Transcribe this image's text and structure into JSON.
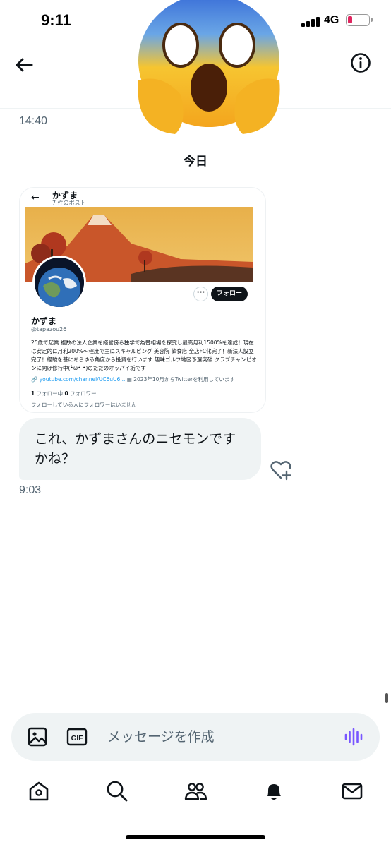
{
  "status_bar": {
    "time": "9:11",
    "network": "4G",
    "battery_color": "#e0245e"
  },
  "header": {
    "back_icon": "back-arrow-icon",
    "info_icon": "info-icon",
    "sticker_icon": "screaming-face-emoji"
  },
  "conversation": {
    "earlier_timestamp": "14:40",
    "date_separator": "今日",
    "attached_screenshot": {
      "back_glyph": "←",
      "top_name": "かずま",
      "posts_count": "7 件のポスト",
      "more_glyph": "···",
      "follow_label": "フォロー",
      "display_name": "かずま",
      "handle": "@tapazou26",
      "bio": "25歳で起業 複数の法人企業を経営傍ら独学で為替相場を探究し最高月利1500%を達成！現在は安定的に月利200%〜程度で主にスキャルピング 美容院 飲食店 全店FC化完了！新法人設立完了！経験を基にあらゆる角度から投資を行います 趣味ゴルフ地区予選突破 クラブチャンピオンに向け修行中(•̀ω•́ •)のただのオッパイ垢です",
      "link": "youtube.com/channel/UC6uU6...",
      "joined": "2023年10月からTwitterを利用しています",
      "following_count": "1",
      "following_label": "フォロー中",
      "followers_count": "0",
      "followers_label": "フォロワー",
      "followers_note": "フォローしている人にフォロワーはいません"
    },
    "message": {
      "text": "これ、かずまさんのニセモンですかね？",
      "timestamp": "9:03",
      "react_icon": "heart-plus-icon"
    }
  },
  "composer": {
    "placeholder": "メッセージを作成",
    "image_icon": "image-icon",
    "gif_icon": "gif-icon",
    "voice_icon": "voice-wave-icon",
    "accent_color": "#7856ff"
  },
  "nav": {
    "items": [
      "home-icon",
      "search-icon",
      "communities-icon",
      "notifications-icon",
      "messages-icon"
    ]
  }
}
